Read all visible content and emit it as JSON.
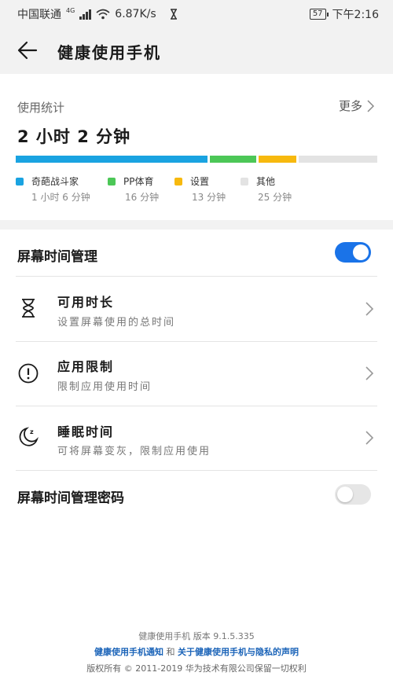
{
  "status_bar": {
    "carrier": "中国联通",
    "network": "4G",
    "speed": "6.87K/s",
    "battery": "57",
    "time": "下午2:16"
  },
  "app_bar": {
    "title": "健康使用手机"
  },
  "usage": {
    "label": "使用统计",
    "more": "更多",
    "total": "2 小时 2 分钟",
    "segments": [
      {
        "name": "奇葩战斗家",
        "time": "1 小时 6 分钟",
        "color": "#1aa3e1",
        "fraction": 0.541
      },
      {
        "name": "PP体育",
        "time": "16 分钟",
        "color": "#4cc757",
        "fraction": 0.131
      },
      {
        "name": "设置",
        "time": "13 分钟",
        "color": "#f7b90e",
        "fraction": 0.107
      },
      {
        "name": "其他",
        "time": "25 分钟",
        "color": "#e3e3e3",
        "fraction": 0.205
      }
    ]
  },
  "screen_time": {
    "label": "屏幕时间管理",
    "enabled": true,
    "accent": "#1a73e8"
  },
  "items": [
    {
      "title": "可用时长",
      "subtitle": "设置屏幕使用的总时间",
      "icon": "hourglass-icon"
    },
    {
      "title": "应用限制",
      "subtitle": "限制应用使用时间",
      "icon": "alert-circle-icon"
    },
    {
      "title": "睡眠时间",
      "subtitle": "可将屏幕变灰，限制应用使用",
      "icon": "moon-sleep-icon"
    }
  ],
  "password": {
    "label": "屏幕时间管理密码",
    "enabled": false
  },
  "footer": {
    "version": "健康使用手机  版本 9.1.5.335",
    "notice_link": "健康使用手机通知",
    "and": "和",
    "privacy_link": "关于健康使用手机与隐私的声明",
    "copyright": "版权所有 © 2011-2019 华为技术有限公司保留一切权利"
  }
}
